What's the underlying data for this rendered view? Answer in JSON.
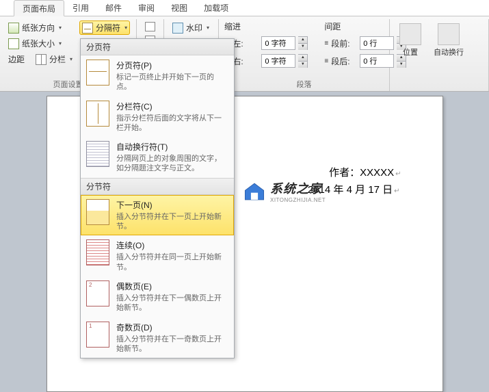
{
  "tabs": {
    "layout": "页面布局",
    "refs": "引用",
    "mail": "邮件",
    "review": "审阅",
    "view": "视图",
    "addins": "加载项"
  },
  "ribbon": {
    "page_setup": {
      "orientation": "纸张方向",
      "size": "纸张大小",
      "margins": "边距",
      "columns": "分栏",
      "breaks": "分隔符",
      "group_label": "页面设置"
    },
    "line_numbers_icon": "行号",
    "watermark": "水印",
    "indent": {
      "label": "缩进",
      "left_label": "左:",
      "left_value": "0 字符",
      "right_label": "右:",
      "right_value": "0 字符"
    },
    "spacing": {
      "label": "间距",
      "before_label": "段前:",
      "before_value": "0 行",
      "after_label": "段后:",
      "after_value": "0 行"
    },
    "paragraph_label": "段落",
    "position": "位置",
    "wrap": "自动换行"
  },
  "dropdown": {
    "section1": "分页符",
    "items1": [
      {
        "title": "分页符(P)",
        "desc": "标记一页终止并开始下一页的点。"
      },
      {
        "title": "分栏符(C)",
        "desc": "指示分栏符后面的文字将从下一栏开始。"
      },
      {
        "title": "自动换行符(T)",
        "desc": "分隔网页上的对象周围的文字，如分隔题注文字与正文。"
      }
    ],
    "section2": "分节符",
    "items2": [
      {
        "title": "下一页(N)",
        "desc": "插入分节符并在下一页上开始新节。"
      },
      {
        "title": "连续(O)",
        "desc": "插入分节符并在同一页上开始新节。"
      },
      {
        "title": "偶数页(E)",
        "desc": "插入分节符并在下一偶数页上开始新节。"
      },
      {
        "title": "奇数页(D)",
        "desc": "插入分节符并在下一奇数页上开始新节。"
      }
    ]
  },
  "document": {
    "line1_prefix": "作者：",
    "line1_author": "XXXXX",
    "line2": "2014 年 4 月 17 日"
  },
  "watermark": {
    "cn": "系统之家",
    "en": "XITONGZHIJIA.NET"
  }
}
